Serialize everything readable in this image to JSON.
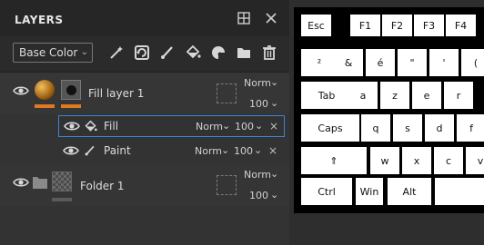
{
  "panel": {
    "title": "LAYERS",
    "blend_mode_select": "Base Color",
    "icons": {
      "dock": "dock-icon",
      "close": "close-icon",
      "tools": [
        "magic-wand-icon",
        "refresh-icon",
        "brush-icon",
        "fill-bucket-icon",
        "palette-icon",
        "folder-icon",
        "trash-icon"
      ]
    }
  },
  "layers": [
    {
      "name": "Fill layer 1",
      "blend": "Norm",
      "opacity": "100",
      "subitems": [
        {
          "name": "Fill",
          "blend": "Norm",
          "opacity": "100"
        },
        {
          "name": "Paint",
          "blend": "Norm",
          "opacity": "100"
        }
      ]
    },
    {
      "name": "Folder 1",
      "blend": "Norm",
      "opacity": "100"
    }
  ],
  "keyboard": {
    "keys": [
      {
        "label": "Esc"
      },
      {
        "label": "F1"
      },
      {
        "label": "F2"
      },
      {
        "label": "F3"
      },
      {
        "label": "F4"
      },
      {
        "label": "²"
      },
      {
        "label": "&"
      },
      {
        "label": "é"
      },
      {
        "label": "\""
      },
      {
        "label": "'"
      },
      {
        "label": "("
      },
      {
        "label": "Tab"
      },
      {
        "label": "a"
      },
      {
        "label": "z"
      },
      {
        "label": "e"
      },
      {
        "label": "r"
      },
      {
        "label": "Caps"
      },
      {
        "label": "q"
      },
      {
        "label": "s"
      },
      {
        "label": "d"
      },
      {
        "label": "f"
      },
      {
        "label": "⇑"
      },
      {
        "label": "w"
      },
      {
        "label": "x"
      },
      {
        "label": "c"
      },
      {
        "label": "v"
      },
      {
        "label": "Ctrl"
      },
      {
        "label": "Win"
      },
      {
        "label": "Alt"
      },
      {
        "label": ""
      }
    ]
  },
  "colors": {
    "accent_orange": "#e07a20",
    "selection_blue": "#3a86d6"
  }
}
